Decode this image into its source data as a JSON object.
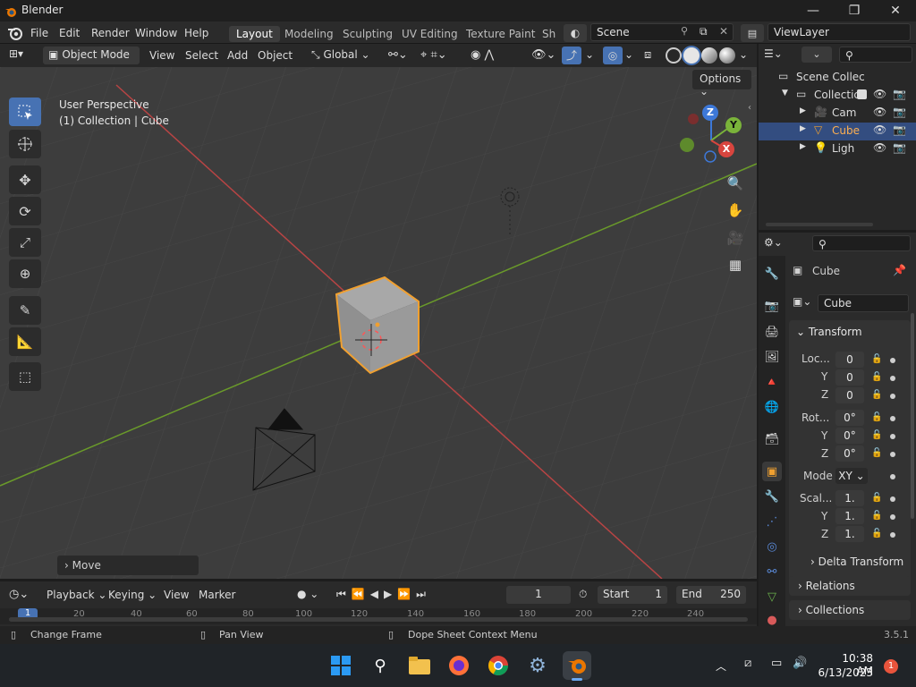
{
  "window": {
    "title": "Blender",
    "min": "—",
    "max": "❐",
    "close": "✕"
  },
  "topmenu": [
    "File",
    "Edit",
    "Render",
    "Window",
    "Help"
  ],
  "workspaces": [
    "Layout",
    "Modeling",
    "Sculpting",
    "UV Editing",
    "Texture Paint",
    "Sh"
  ],
  "scene": {
    "name": "Scene",
    "viewlayer": "ViewLayer"
  },
  "viewport_header": {
    "mode": "Object Mode",
    "menus": [
      "View",
      "Select",
      "Add",
      "Object"
    ],
    "orientation": "Global",
    "options": "Options"
  },
  "viewport": {
    "perspective": "User Perspective",
    "collection": "(1) Collection | Cube",
    "operator_panel": "Move",
    "gizmo": {
      "z": "Z",
      "y": "Y",
      "x": "X"
    }
  },
  "timeline": {
    "menus": [
      "Playback",
      "Keying",
      "View",
      "Marker"
    ],
    "current_frame": "1",
    "start_label": "Start",
    "start": "1",
    "end_label": "End",
    "end": "250",
    "ticks": [
      "1",
      "20",
      "40",
      "60",
      "80",
      "100",
      "120",
      "140",
      "160",
      "180",
      "200",
      "220",
      "240"
    ]
  },
  "status": {
    "left": "Change Frame",
    "middle": "Pan View",
    "right": "Dope Sheet Context Menu",
    "version": "3.5.1"
  },
  "outliner": {
    "rows": [
      {
        "label": "Scene Collec"
      },
      {
        "label": "Collectic"
      },
      {
        "label": "Cam"
      },
      {
        "label": "Cube"
      },
      {
        "label": "Ligh"
      }
    ]
  },
  "properties": {
    "object_name": "Cube",
    "data_name": "Cube",
    "transform": "Transform",
    "location_label": "Loc...",
    "rotation_label": "Rot...",
    "scale_label": "Scal...",
    "y": "Y",
    "z": "Z",
    "loc": [
      "0",
      "0",
      "0"
    ],
    "rot": [
      "0°",
      "0°",
      "0°"
    ],
    "scale": [
      "1.",
      "1.",
      "1."
    ],
    "mode_label": "Mode",
    "mode": "XY",
    "delta": "Delta Transform",
    "relations": "Relations",
    "collections": "Collections"
  },
  "taskbar": {
    "time": "10:38 AM",
    "date": "6/13/2023",
    "badge": "1"
  },
  "colors": {
    "accent": "#4772b3",
    "selected_orange": "#f0a030",
    "x_axis": "#b84444",
    "y_axis": "#6a9a2a"
  }
}
